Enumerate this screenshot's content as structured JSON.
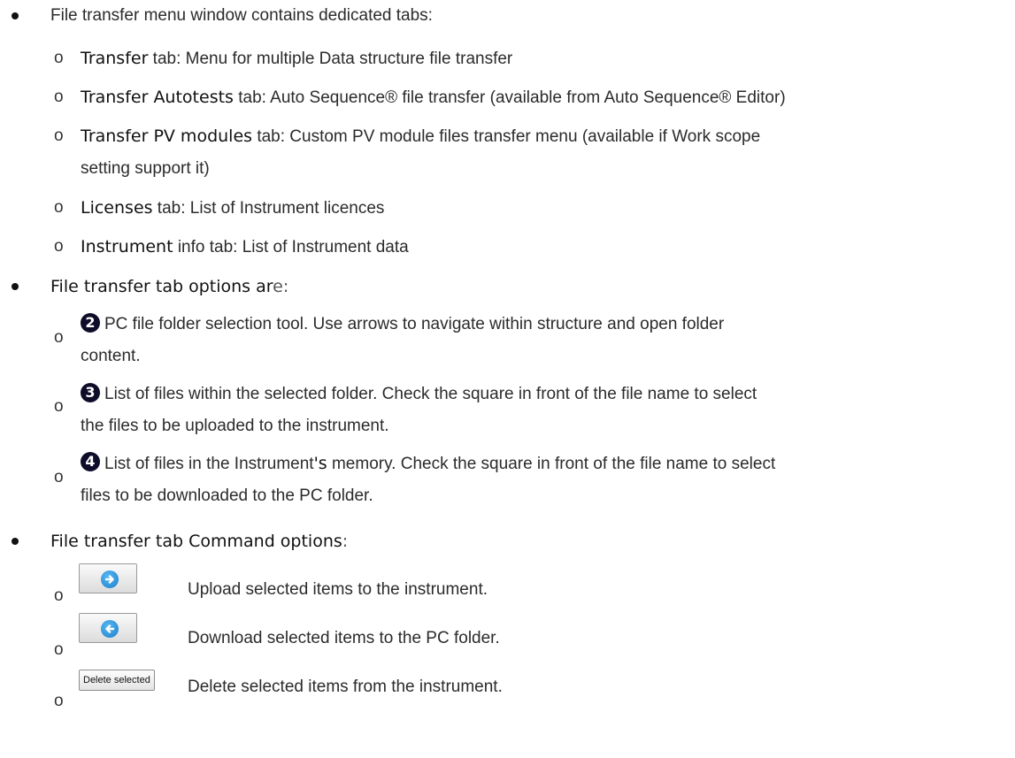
{
  "sections": {
    "tabs_intro": {
      "heading": "File transfer menu window contains dedicated tabs:",
      "items": [
        {
          "keyword": "Transfer",
          "rest": " tab: Menu for multiple Data structure file transfer"
        },
        {
          "keyword": "Transfer Autotests",
          "rest": " tab: Auto Sequence® file transfer (available from Auto Sequence® Editor)"
        },
        {
          "keyword": "Transfer PV modules",
          "rest": " tab: Custom PV module files transfer menu (available if Work scope",
          "rest2": "setting support it)"
        },
        {
          "keyword": "Licenses",
          "rest": " tab: List of Instrument licences"
        },
        {
          "keyword": "Instrument",
          "rest": " info tab: List of Instrument data"
        }
      ]
    },
    "tab_options": {
      "heading_main": "File transfer tab options ar",
      "heading_tail": "e:",
      "items": [
        {
          "number": "2",
          "line1": " PC file folder selection tool. Use arrows to navigate within structure and open folder",
          "line2": "content."
        },
        {
          "number": "3",
          "line1": " List of files within the selected folder. Check the square in front of the file name to select",
          "line2": "the files to be uploaded to the instrument."
        },
        {
          "number": "4",
          "line1a": " List of files in the Instrument",
          "line1b": "'s",
          "line1c": " memory. Check the square in front of the file name to select",
          "line2": "files to be downloaded to the PC folder."
        }
      ]
    },
    "commands": {
      "heading_main": "File transfer tab Command options",
      "heading_tail": ":",
      "items": [
        {
          "icon": "arrow-right-icon",
          "text": "Upload selected items to the instrument."
        },
        {
          "icon": "arrow-left-icon",
          "text": "Download selected items to the PC folder."
        },
        {
          "button_label": "Delete selected",
          "text": "Delete selected items from the instrument."
        }
      ]
    }
  },
  "sub_marker": "o",
  "colors": {
    "icon_blue": "#1b7fc9",
    "number_bg": "#0d0d2a"
  }
}
